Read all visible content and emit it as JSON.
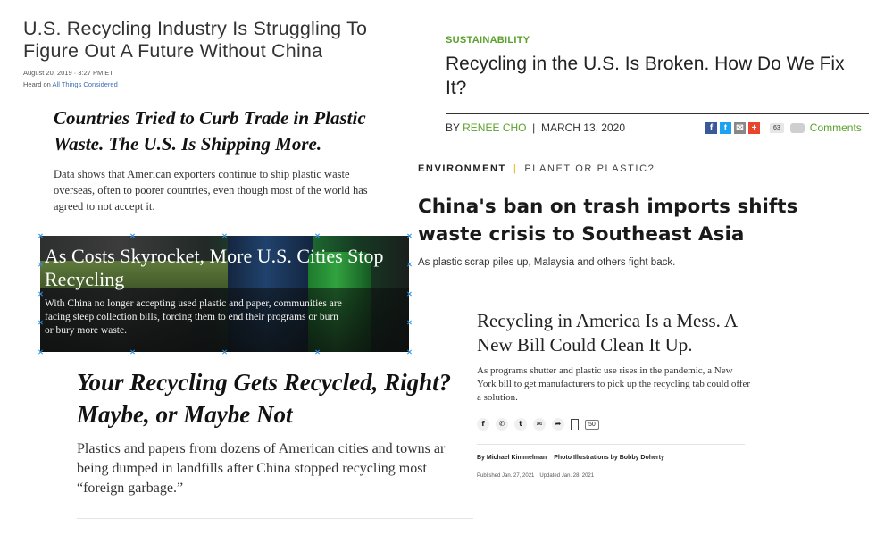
{
  "npr": {
    "title": "U.S. Recycling Industry Is Struggling To Figure Out A Future Without China",
    "date": "August 20, 2019 · 3:27 PM ET",
    "heard_on_prefix": "Heard on",
    "heard_on_link": "All Things Considered"
  },
  "nyt_trade": {
    "title": "Countries Tried to Curb Trade in Plastic Waste. The U.S. Is Shipping More.",
    "summary": "Data shows that American exporters continue to ship plastic waste overseas, often to poorer countries, even though most of the world has agreed to not accept it."
  },
  "columbia": {
    "kicker": "SUSTAINABILITY",
    "title": "Recycling in the U.S. Is Broken. How Do We Fix It?",
    "by_prefix": "BY",
    "author": "RENEE CHO",
    "separator": "|",
    "date": "MARCH 13, 2020",
    "share_count": "63",
    "comments_label": "Comments",
    "share_icons": [
      {
        "name": "facebook-icon",
        "glyph": "f",
        "color": "#3b5998"
      },
      {
        "name": "twitter-icon",
        "glyph": "t",
        "color": "#1da1f2"
      },
      {
        "name": "email-icon",
        "glyph": "✉",
        "color": "#888888"
      },
      {
        "name": "plus-icon",
        "glyph": "+",
        "color": "#e8452c"
      }
    ]
  },
  "environment": {
    "section": "ENVIRONMENT",
    "subsection": "PLANET OR PLASTIC?",
    "divider": "|",
    "title": "China's ban on trash imports shifts waste crisis to Southeast Asia",
    "dek": "As plastic scrap piles up, Malaysia and others fight back."
  },
  "image_story": {
    "title": "As Costs Skyrocket, More U.S. Cities Stop Recycling",
    "summary": "With China no longer accepting used plastic and paper, communities are facing steep collection bills, forcing them to end their programs or burn or bury more waste."
  },
  "nyt_maybe": {
    "title": "Your Recycling Gets Recycled, Right? Maybe, or Maybe Not",
    "summary_lines": [
      "Plastics and papers from dozens of American cities and towns ar",
      "being dumped in landfills after China stopped recycling most",
      "“foreign garbage.”"
    ]
  },
  "nyt_bill": {
    "title": "Recycling in America Is a Mess. A New Bill Could Clean It Up.",
    "summary": "As programs shutter and plastic use rises in the pandemic, a New York bill to get manufacturers to pick up the recycling tab could offer a solution.",
    "share_icons": [
      {
        "name": "facebook-icon",
        "glyph": "f"
      },
      {
        "name": "whatsapp-icon",
        "glyph": "✆"
      },
      {
        "name": "twitter-icon",
        "glyph": "t"
      },
      {
        "name": "email-icon",
        "glyph": "✉"
      },
      {
        "name": "share-arrow-icon",
        "glyph": "➦"
      }
    ],
    "comment_count": "50",
    "byline": "By Michael Kimmelman",
    "credit": "Photo Illustrations by Bobby Doherty",
    "published": "Published Jan. 27, 2021",
    "updated": "Updated Jan. 28, 2021"
  }
}
